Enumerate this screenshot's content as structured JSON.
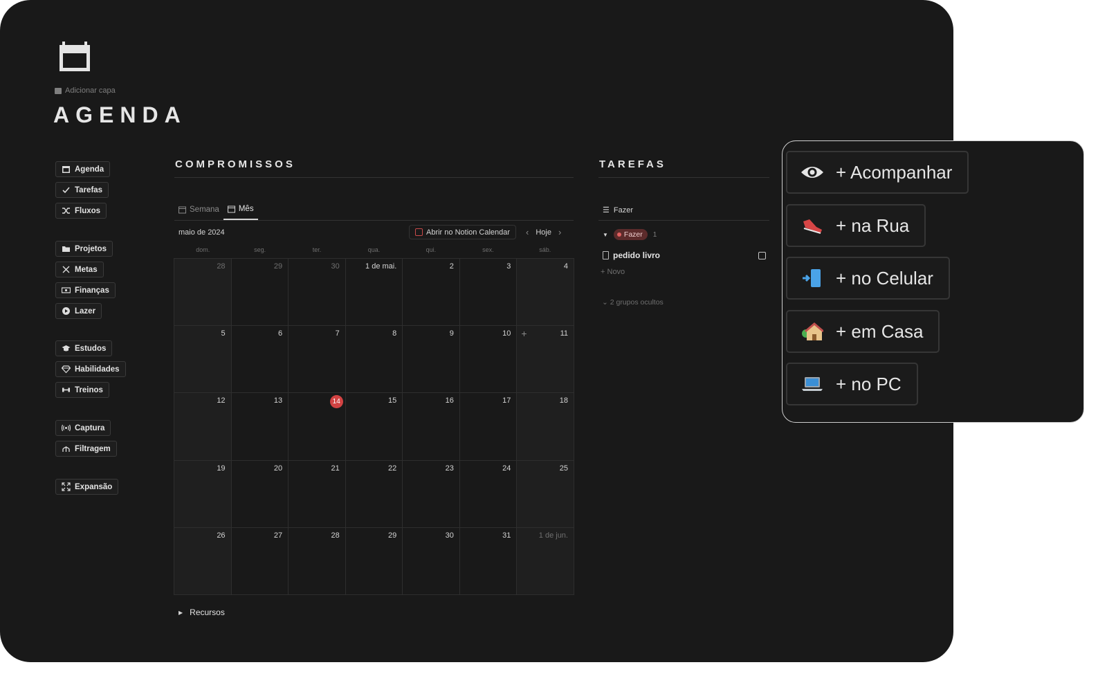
{
  "page": {
    "add_cover": "Adicionar capa",
    "title": "AGENDA"
  },
  "sidebar": {
    "items": [
      {
        "label": "Agenda",
        "icon": "calendar-icon"
      },
      {
        "label": "Tarefas",
        "icon": "check-icon"
      },
      {
        "label": "Fluxos",
        "icon": "shuffle-icon"
      },
      {
        "label": "Projetos",
        "icon": "folder-icon"
      },
      {
        "label": "Metas",
        "icon": "target-icon"
      },
      {
        "label": "Finanças",
        "icon": "money-icon"
      },
      {
        "label": "Lazer",
        "icon": "play-icon"
      },
      {
        "label": "Estudos",
        "icon": "graduation-cap-icon"
      },
      {
        "label": "Habilidades",
        "icon": "diamond-icon"
      },
      {
        "label": "Treinos",
        "icon": "dumbbell-icon"
      },
      {
        "label": "Captura",
        "icon": "broadcast-icon"
      },
      {
        "label": "Filtragem",
        "icon": "funnel-icon"
      },
      {
        "label": "Expansão",
        "icon": "expand-icon"
      }
    ]
  },
  "compromissos": {
    "title": "COMPROMISSOS",
    "tabs": [
      "Semana",
      "Mês"
    ],
    "active_tab": "Mês",
    "month_label": "maio de 2024",
    "open_notion": "Abrir no Notion Calendar",
    "today_label": "Hoje",
    "weekdays": [
      "dom.",
      "seg.",
      "ter.",
      "qua.",
      "qui.",
      "sex.",
      "sáb."
    ],
    "days": [
      "28",
      "29",
      "30",
      "1 de mai.",
      "2",
      "3",
      "4",
      "5",
      "6",
      "7",
      "8",
      "9",
      "10",
      "11",
      "12",
      "13",
      "14",
      "15",
      "16",
      "17",
      "18",
      "19",
      "20",
      "21",
      "22",
      "23",
      "24",
      "25",
      "26",
      "27",
      "28",
      "29",
      "30",
      "31",
      "1 de jun."
    ],
    "today_index": 16,
    "recursos": "Recursos"
  },
  "tarefas": {
    "title": "TAREFAS",
    "view": "Fazer",
    "group_label": "Fazer",
    "group_count": "1",
    "task": "pedido livro",
    "new_label": "Novo",
    "hidden_groups": "2 grupos ocultos"
  },
  "popover": {
    "buttons": [
      {
        "label": "+ Acompanhar",
        "icon": "eye-icon"
      },
      {
        "label": "+ na Rua",
        "icon": "sneaker-icon"
      },
      {
        "label": "+ no Celular",
        "icon": "phone-icon"
      },
      {
        "label": "+ em Casa",
        "icon": "house-icon"
      },
      {
        "label": "+ no PC",
        "icon": "laptop-icon"
      }
    ]
  },
  "colors": {
    "background": "#191919",
    "today": "#d24343",
    "pill": "#5c2b2b"
  }
}
